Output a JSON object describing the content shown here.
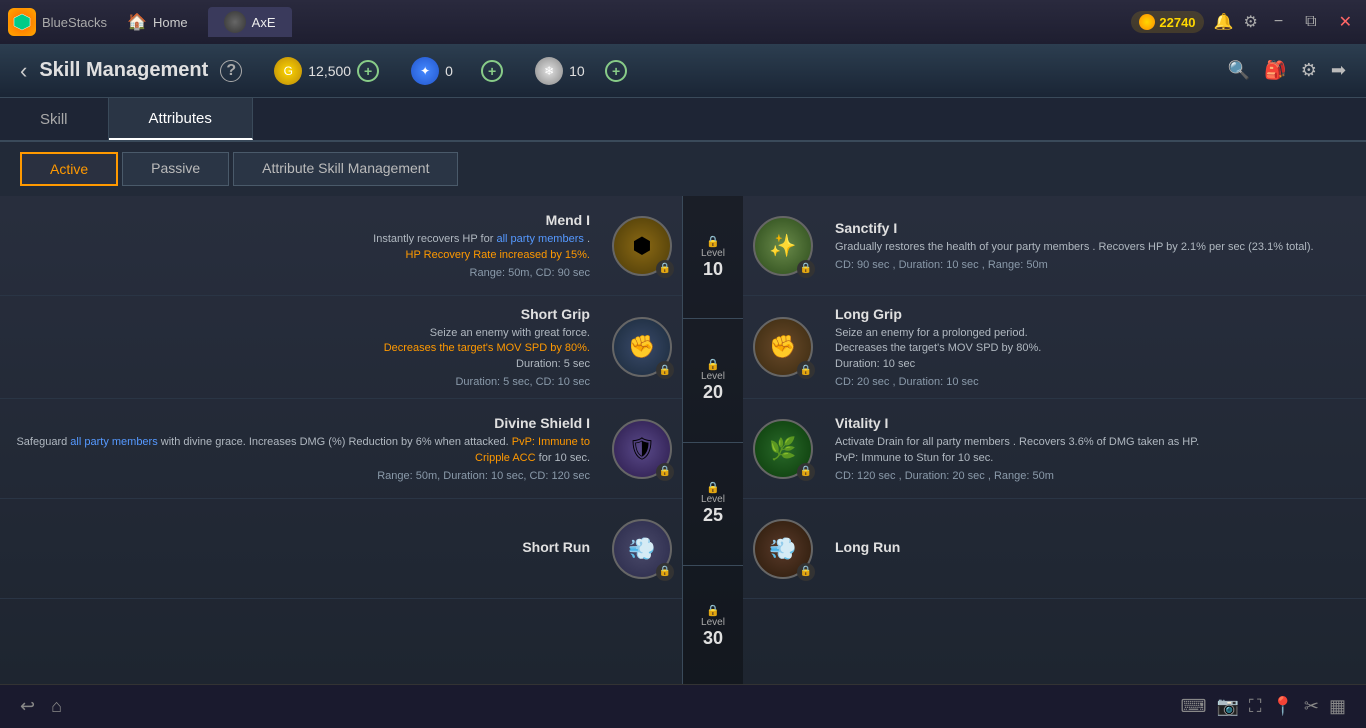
{
  "titleBar": {
    "appName": "BlueStacks",
    "homeLabel": "Home",
    "gameTab": "AxE",
    "coins": "22740",
    "minBtn": "−",
    "maxBtn": "⧉",
    "closeBtn": "✕"
  },
  "header": {
    "backLabel": "‹",
    "title": "Skill Management",
    "helpLabel": "?",
    "currency1": {
      "value": "12,500",
      "addLabel": "+"
    },
    "currency2": {
      "value": "0",
      "addLabel": "+"
    },
    "currency3": {
      "value": "10",
      "addLabel": "+"
    }
  },
  "tabs": [
    {
      "id": "skill",
      "label": "Skill",
      "active": false
    },
    {
      "id": "attributes",
      "label": "Attributes",
      "active": true
    }
  ],
  "subtabs": [
    {
      "id": "active",
      "label": "Active",
      "active": true
    },
    {
      "id": "passive",
      "label": "Passive",
      "active": false
    },
    {
      "id": "attribute-skill",
      "label": "Attribute Skill Management",
      "active": false
    }
  ],
  "skills": {
    "left": [
      {
        "id": "mend",
        "name": "Mend I",
        "desc_plain": "Instantly recovers HP for ",
        "desc_blue": "all party members",
        "desc_plain2": ".",
        "desc_orange": "HP Recovery Rate increased by 15%.",
        "meta": "Range: 50m, CD: 90 sec",
        "iconType": "mend",
        "iconEmoji": "🌟"
      },
      {
        "id": "short-grip",
        "name": "Short Grip",
        "desc_plain": "Seize an enemy with great force.",
        "desc_orange": "Decreases the target's MOV SPD by 80%.",
        "desc_plain2": "Duration: 5 sec",
        "meta": "Duration: 5 sec, CD: 10 sec",
        "iconType": "short-grip",
        "iconEmoji": "✊"
      },
      {
        "id": "divine-shield",
        "name": "Divine Shield I",
        "desc_plain": "Safeguard ",
        "desc_blue": "all party members",
        "desc_plain2": " with divine grace. Increases DMG (%) Reduction by 6% when attacked.",
        "desc_orange": "PvP: Immune to Cripple ACC",
        "desc_plain3": " for 10 sec.",
        "meta": "Range: 50m, Duration: 10 sec, CD: 120 sec",
        "iconType": "divine",
        "iconEmoji": "🛡"
      },
      {
        "id": "short-run",
        "name": "Short Run",
        "desc_plain": "",
        "meta": "",
        "iconType": "short-run",
        "iconEmoji": "💨"
      }
    ],
    "right": [
      {
        "id": "sanctify",
        "name": "Sanctify I",
        "desc_plain": "Gradually restores the health of your ",
        "desc_blue": "party members",
        "desc_plain2": ". Recovers HP by ",
        "desc_orange": "2.1% per sec (23.1% total).",
        "meta": "CD: 90 sec , Duration: 10 sec , Range: 50m",
        "iconType": "sanctify",
        "iconEmoji": "✨",
        "level": "10"
      },
      {
        "id": "long-grip",
        "name": "Long Grip",
        "desc_plain": "Seize an enemy for a prolonged period.",
        "desc_orange": "Decreases the target's MOV SPD by 80%.",
        "desc_plain2": "Duration: 10 sec",
        "meta": "CD: 20 sec , Duration: 10 sec",
        "iconType": "long-grip",
        "iconEmoji": "✊",
        "level": "20"
      },
      {
        "id": "vitality",
        "name": "Vitality I",
        "desc_plain": "Activate Drain for ",
        "desc_blue": "all party members",
        "desc_plain2": ". Recovers ",
        "desc_orange": "3.6% of DMG taken as HP.",
        "desc_pvp": "PvP: Immune to Stun",
        "desc_pvp2": " for 10 sec.",
        "meta": "CD: 120 sec , Duration: 20 sec , Range: 50m",
        "iconType": "vitality",
        "iconEmoji": "🌿",
        "level": "25"
      },
      {
        "id": "long-run",
        "name": "Long Run",
        "desc_plain": "",
        "meta": "",
        "iconType": "long-run",
        "iconEmoji": "💨",
        "level": "30"
      }
    ],
    "levels": [
      "10",
      "20",
      "25",
      "30"
    ]
  },
  "bottomBar": {
    "backIcon": "↩",
    "homeIcon": "⌂"
  }
}
